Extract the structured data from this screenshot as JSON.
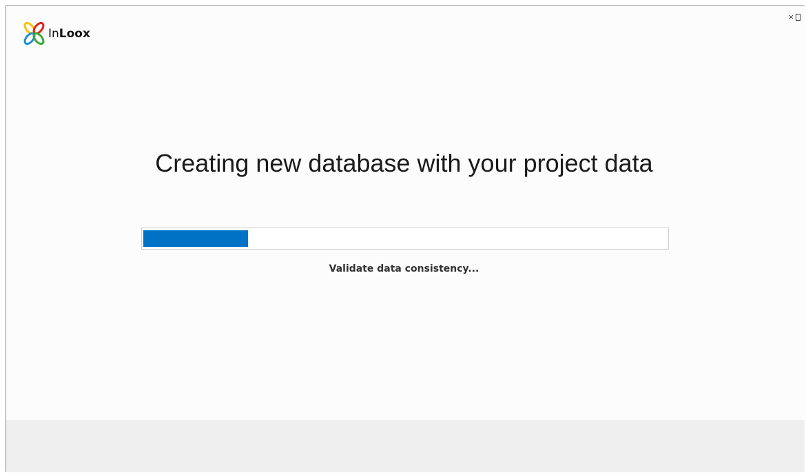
{
  "app": {
    "logo_text_light": "In",
    "logo_text_bold": "Loox"
  },
  "window_controls": {
    "close_glyph": "×"
  },
  "main": {
    "title": "Creating new database with your project data",
    "status_text": "Validate data consistency...",
    "progress_fraction": 0.2
  },
  "colors": {
    "accent": "#0072c6",
    "background": "#fcfcfc",
    "footer": "#efefef"
  }
}
